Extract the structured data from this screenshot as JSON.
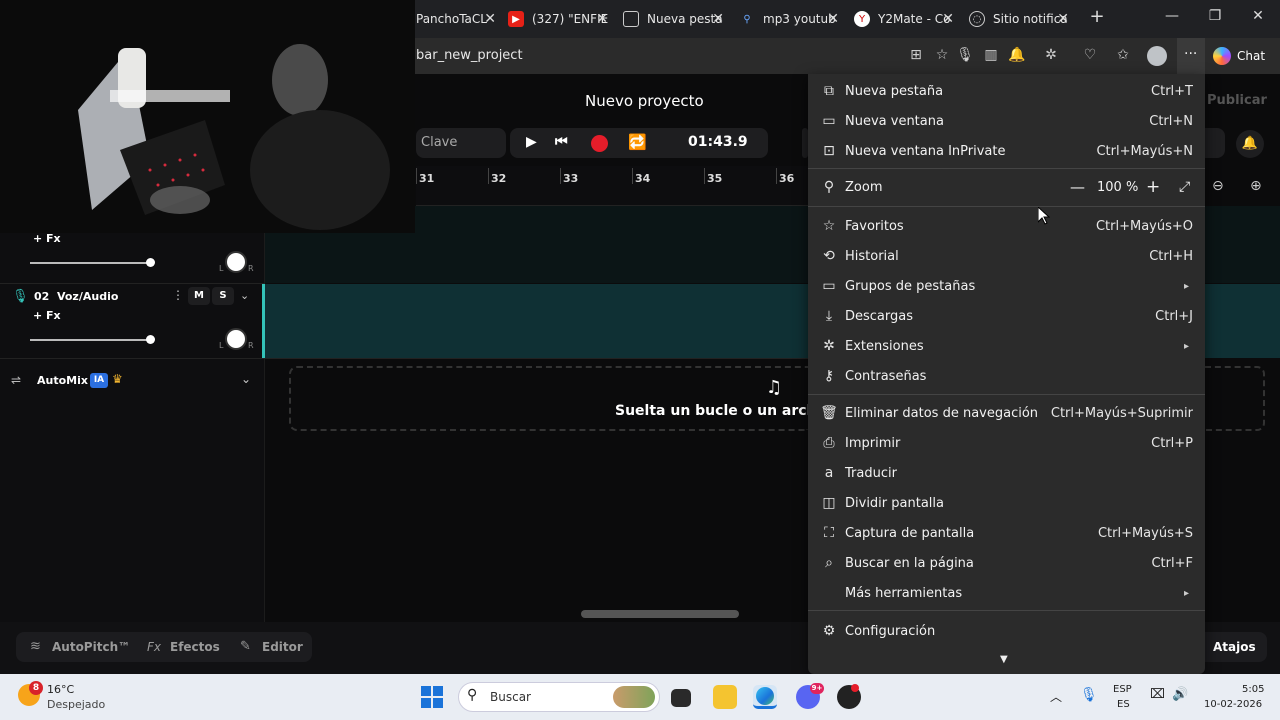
{
  "tabs": [
    {
      "title": "PanchoTaCL",
      "icon": "tab-icon"
    },
    {
      "title": "(327) \"ENFIE",
      "icon": "youtube-icon"
    },
    {
      "title": "Nueva pesta",
      "icon": "new-tab-icon"
    },
    {
      "title": "mp3 youtub",
      "icon": "search-icon"
    },
    {
      "title": "Y2Mate - Co",
      "icon": "y2mate-icon"
    },
    {
      "title": "Sitio notifica",
      "icon": "site-icon"
    }
  ],
  "address": {
    "url": "bar_new_project"
  },
  "toolbar": {
    "chat_label": "Chat"
  },
  "app": {
    "project_title": "Nuevo proyecto",
    "key_label": "Clave",
    "timer": "01:43.9",
    "publish_label": "Publicar",
    "ruler": [
      "31",
      "32",
      "33",
      "34",
      "35",
      "36"
    ],
    "track1": {
      "fx": "+ Fx",
      "pan_l": "L",
      "pan_r": "R"
    },
    "track2": {
      "name": "02  Voz/Audio",
      "mute": "M",
      "solo": "S",
      "fx": "+ Fx",
      "pan_l": "L",
      "pan_r": "R"
    },
    "automix": {
      "label": "AutoMix",
      "badge": "IA"
    },
    "dropzone_text": "Suelta un bucle o un archivo",
    "bottom": {
      "autopitch": "AutoPitch™",
      "effects_prefix": "Fx",
      "effects": "Efectos",
      "editor": "Editor",
      "shortcuts": "Atajos"
    }
  },
  "menu": {
    "items": [
      {
        "label": "Nueva pestaña",
        "shortcut": "Ctrl+T",
        "icon": "new-tab-icon"
      },
      {
        "label": "Nueva ventana",
        "shortcut": "Ctrl+N",
        "icon": "window-icon"
      },
      {
        "label": "Nueva ventana InPrivate",
        "shortcut": "Ctrl+Mayús+N",
        "icon": "inprivate-icon"
      },
      {
        "label": "Favoritos",
        "shortcut": "Ctrl+Mayús+O",
        "icon": "star-icon"
      },
      {
        "label": "Historial",
        "shortcut": "Ctrl+H",
        "icon": "history-icon"
      },
      {
        "label": "Grupos de pestañas",
        "shortcut": "",
        "icon": "tab-groups-icon"
      },
      {
        "label": "Descargas",
        "shortcut": "Ctrl+J",
        "icon": "download-icon"
      },
      {
        "label": "Extensiones",
        "shortcut": "",
        "icon": "puzzle-icon"
      },
      {
        "label": "Contraseñas",
        "shortcut": "",
        "icon": "key-icon"
      },
      {
        "label": "Eliminar datos de navegación",
        "shortcut": "Ctrl+Mayús+Suprimir",
        "icon": "trash-icon"
      },
      {
        "label": "Imprimir",
        "shortcut": "Ctrl+P",
        "icon": "printer-icon"
      },
      {
        "label": "Traducir",
        "shortcut": "",
        "icon": "translate-icon"
      },
      {
        "label": "Dividir pantalla",
        "shortcut": "",
        "icon": "split-screen-icon"
      },
      {
        "label": "Captura de pantalla",
        "shortcut": "Ctrl+Mayús+S",
        "icon": "screenshot-icon"
      },
      {
        "label": "Buscar en la página",
        "shortcut": "Ctrl+F",
        "icon": "find-icon"
      },
      {
        "label": "Más herramientas",
        "shortcut": "",
        "icon": ""
      },
      {
        "label": "Configuración",
        "shortcut": "",
        "icon": "gear-icon"
      }
    ],
    "zoom": {
      "label": "Zoom",
      "value": "100 %"
    }
  },
  "taskbar": {
    "weather_temp": "16°C",
    "weather_desc": "Despejado",
    "weather_badge": "8",
    "search_placeholder": "Buscar",
    "lang_top": "ESP",
    "lang_bottom": "ES",
    "time": "5:05",
    "date": "10-02-2026",
    "chat_badge": "9+"
  }
}
